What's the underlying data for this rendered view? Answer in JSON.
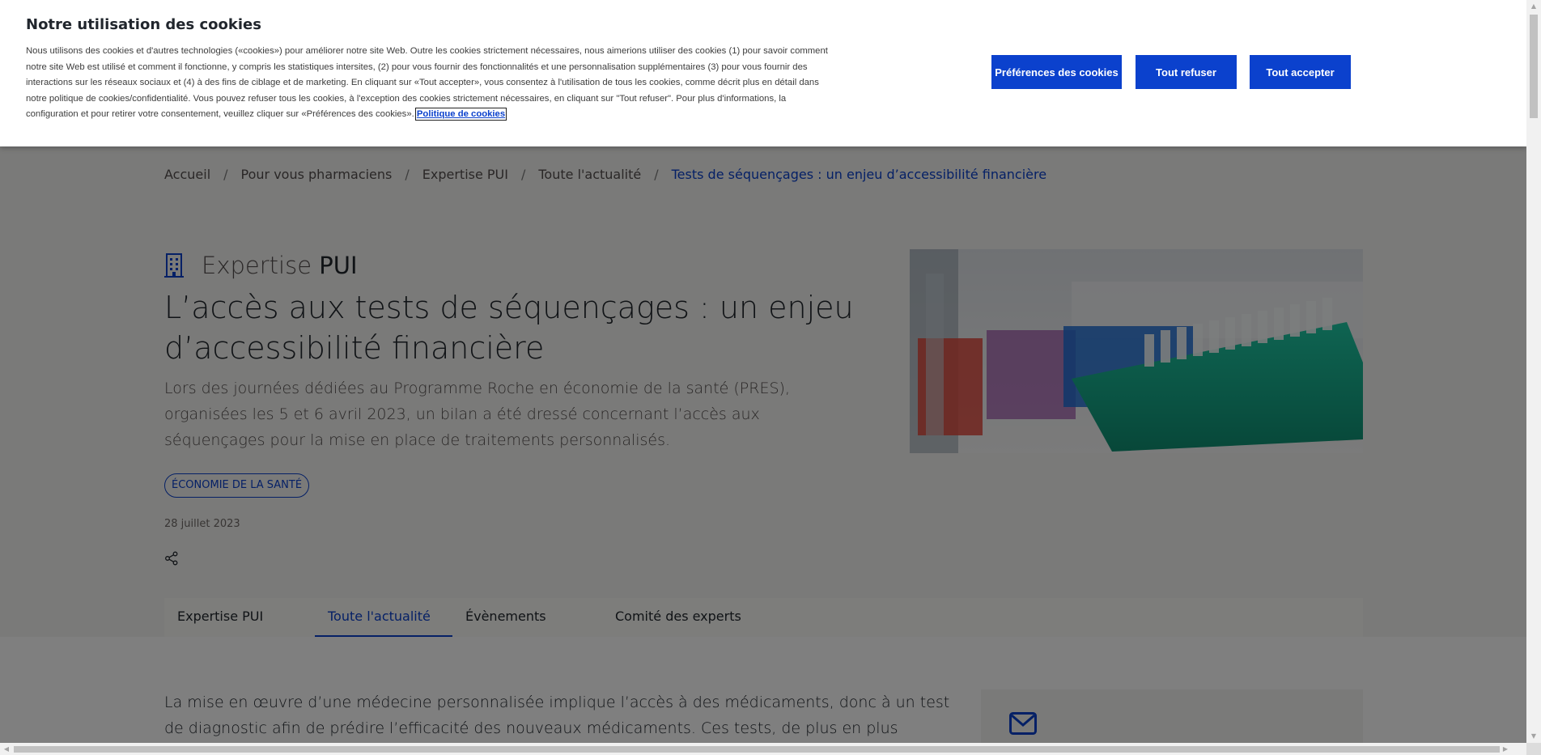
{
  "cookie_banner": {
    "title": "Notre utilisation des cookies",
    "text": "Nous utilisons des cookies et d'autres technologies («cookies») pour améliorer notre site Web. Outre les cookies strictement nécessaires, nous aimerions utiliser des cookies (1) pour savoir comment notre site Web est utilisé et comment il fonctionne, y compris les statistiques intersites, (2) pour vous fournir des fonctionnalités et une personnalisation supplémentaires (3) pour vous fournir des interactions sur les réseaux sociaux et (4) à des fins de ciblage et de marketing. En cliquant sur «Tout accepter», vous consentez à l'utilisation de tous les cookies, comme décrit plus en détail dans notre politique de cookies/confidentialité. Vous pouvez refuser tous les cookies, à l'exception des cookies strictement nécessaires, en cliquant sur \"Tout refuser\". Pour plus d'informations, la configuration et pour retirer votre consentement, veuillez cliquer sur «Préférences des cookies».",
    "policy_link": "Politique de cookies",
    "btn_preferences": "Préférences des cookies",
    "btn_refuse": "Tout refuser",
    "btn_accept": "Tout accepter"
  },
  "breadcrumb": [
    "Accueil",
    "Pour vous pharmaciens",
    "Expertise PUI",
    "Toute l'actualité",
    "Tests de séquençages : un enjeu d’accessibilité financière"
  ],
  "eyebrow": {
    "light": "Expertise",
    "bold": "PUI"
  },
  "article": {
    "title_line1": "L’accès aux tests de séquençages : un enjeu",
    "title_line2": "d’accessibilité financière",
    "lead": "Lors des journées dédiées au Programme Roche en économie de la santé (PRES), organisées les 5 et 6 avril 2023, un bilan a été dressé concernant l’accès aux séquençages pour la mise en place de traitements personnalisés.",
    "tag": "ÉCONOMIE DE LA SANTÉ",
    "date": "28 juillet 2023",
    "body": "La mise en œuvre d’une médecine personnalisée implique l’accès à des médicaments, donc à un test de diagnostic afin de prédire l’efficacité des nouveaux médicaments. Ces tests, de plus en plus courants, sont également de plus en plus"
  },
  "tabs": [
    {
      "label": "Expertise PUI"
    },
    {
      "label": "Toute l'actualité"
    },
    {
      "label": "Évènements"
    },
    {
      "label": "Comité des experts"
    }
  ],
  "colors": {
    "accent": "#0b41cd",
    "overlay": "rgba(0,0,0,0.5)"
  }
}
